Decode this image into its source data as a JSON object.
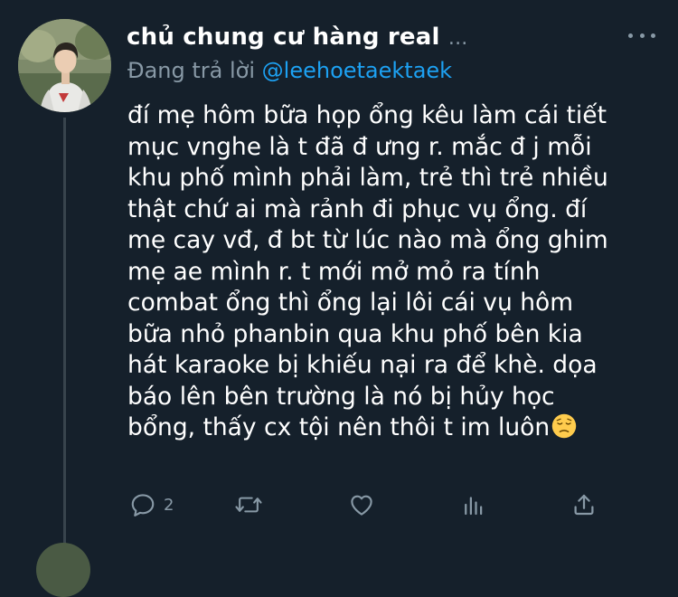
{
  "tweet": {
    "author_name": "chủ chung cư hàng real",
    "name_ellipsis": "...",
    "reply_prefix": "Đang trả lời",
    "reply_handle": "@leehoetaektaek",
    "body_lines": [
      "đí mẹ hôm bữa họp ổng kêu làm cái tiết",
      "mục vnghe là t đã đ ưng r. mắc đ j mỗi",
      "khu phố mình phải làm, trẻ thì trẻ nhiều",
      "thật chứ ai mà rảnh đi phục vụ ổng. đí",
      "mẹ cay vđ, đ bt từ lúc nào mà ổng ghim",
      "mẹ ae mình r. t mới mở mỏ ra tính",
      "combat ổng thì ổng lại lôi cái vụ hôm",
      "bữa nhỏ phanbin qua khu phố bên kia",
      "hát karaoke bị khiếu nại ra để khè. dọa",
      "báo lên bên trường là nó bị hủy học",
      "bổng, thấy cx tội nên thôi t im luôn"
    ],
    "body_emoji": "pensive-face-emoji",
    "actions": {
      "reply_icon": "reply-icon",
      "reply_count": "2",
      "retweet_icon": "retweet-icon",
      "like_icon": "like-icon",
      "analytics_icon": "analytics-icon",
      "share_icon": "share-icon"
    }
  },
  "colors": {
    "background": "#15202b",
    "primary_text": "#ffffff",
    "secondary_text": "#8899a6",
    "link": "#1da1f2",
    "thread_line": "#38444d"
  }
}
